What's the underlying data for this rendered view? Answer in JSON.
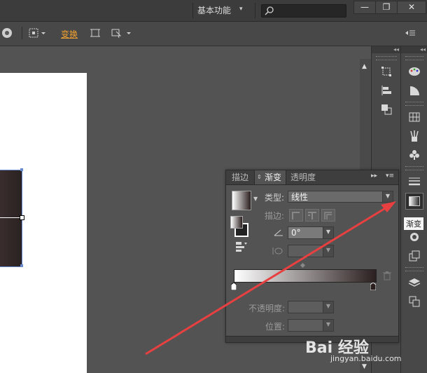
{
  "titlebar": {
    "workspace_label": "基本功能",
    "search_placeholder": "",
    "min_glyph": "—",
    "restore_glyph": "❐",
    "close_glyph": "✕"
  },
  "control_bar": {
    "transform_label": "变换"
  },
  "tooltip": "渐变",
  "gradient_panel": {
    "tabs": [
      "描边",
      "渐变",
      "透明度"
    ],
    "type_label": "类型:",
    "type_value": "线性",
    "stroke_label": "描边:",
    "angle_value": "0°",
    "aspect_value": "",
    "opacity_label": "不透明度:",
    "opacity_value": "",
    "location_label": "位置:",
    "location_value": "",
    "gradient_start_color": "#ffffff",
    "gradient_end_color": "#2b1f1f"
  },
  "watermark": {
    "logo": "Bai 经验",
    "sub": "jingyan.baidu.com"
  },
  "colors": {
    "annotation_arrow": "#e84040",
    "transform_link": "#f0a030"
  }
}
